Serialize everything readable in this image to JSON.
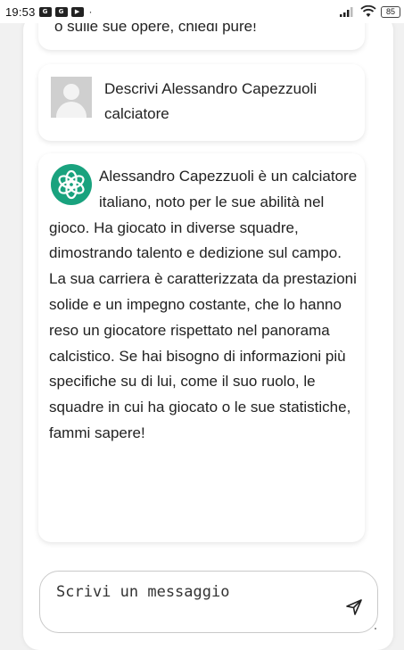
{
  "status_bar": {
    "time": "19:53",
    "notif_1": "G",
    "notif_2": "G",
    "notif_3": "▶",
    "dot": "·",
    "battery": "85"
  },
  "chat": {
    "messages": [
      {
        "role": "assistant",
        "text": "o sulle sue opere, chiedi pure!"
      },
      {
        "role": "user",
        "text": "Descrivi Alessandro Capezzuoli calciatore"
      },
      {
        "role": "assistant",
        "text": "Alessandro Capezzuoli è un calciatore italiano, noto per le sue abilità nel gioco. Ha giocato in diverse squadre, dimostrando talento e dedizione sul campo. La sua carriera è caratterizzata da prestazioni solide e un impegno costante, che lo hanno reso un giocatore rispettato nel panorama calcistico. Se hai bisogno di informazioni più specifiche su di lui, come il suo ruolo, le squadre in cui ha giocato o le sue statistiche, fammi sapere!"
      }
    ]
  },
  "input": {
    "placeholder": "Scrivi un messaggio"
  },
  "icons": {
    "assistant_logo": "openai-logo-icon",
    "user_avatar": "default-avatar-icon",
    "send": "send-icon"
  },
  "colors": {
    "assistant_logo_bg": "#19a27e",
    "panel_bg": "#ffffff",
    "page_bg": "#f1f1f1"
  }
}
